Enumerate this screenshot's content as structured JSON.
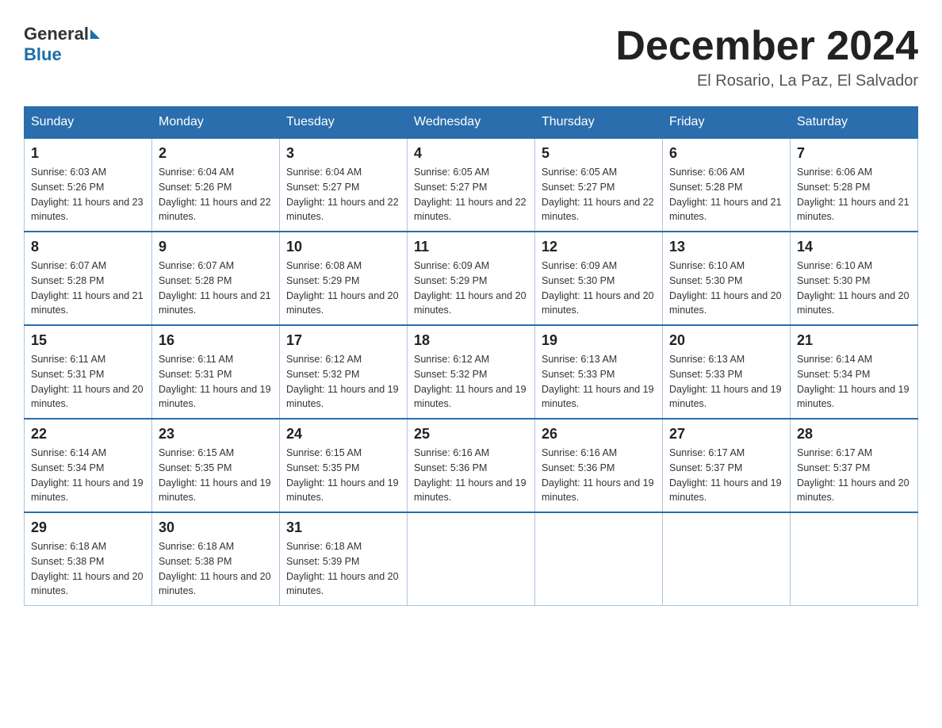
{
  "header": {
    "logo": {
      "general": "General",
      "blue": "Blue"
    },
    "title": "December 2024",
    "location": "El Rosario, La Paz, El Salvador"
  },
  "weekdays": [
    "Sunday",
    "Monday",
    "Tuesday",
    "Wednesday",
    "Thursday",
    "Friday",
    "Saturday"
  ],
  "weeks": [
    [
      {
        "day": "1",
        "sunrise": "6:03 AM",
        "sunset": "5:26 PM",
        "daylight": "11 hours and 23 minutes."
      },
      {
        "day": "2",
        "sunrise": "6:04 AM",
        "sunset": "5:26 PM",
        "daylight": "11 hours and 22 minutes."
      },
      {
        "day": "3",
        "sunrise": "6:04 AM",
        "sunset": "5:27 PM",
        "daylight": "11 hours and 22 minutes."
      },
      {
        "day": "4",
        "sunrise": "6:05 AM",
        "sunset": "5:27 PM",
        "daylight": "11 hours and 22 minutes."
      },
      {
        "day": "5",
        "sunrise": "6:05 AM",
        "sunset": "5:27 PM",
        "daylight": "11 hours and 22 minutes."
      },
      {
        "day": "6",
        "sunrise": "6:06 AM",
        "sunset": "5:28 PM",
        "daylight": "11 hours and 21 minutes."
      },
      {
        "day": "7",
        "sunrise": "6:06 AM",
        "sunset": "5:28 PM",
        "daylight": "11 hours and 21 minutes."
      }
    ],
    [
      {
        "day": "8",
        "sunrise": "6:07 AM",
        "sunset": "5:28 PM",
        "daylight": "11 hours and 21 minutes."
      },
      {
        "day": "9",
        "sunrise": "6:07 AM",
        "sunset": "5:28 PM",
        "daylight": "11 hours and 21 minutes."
      },
      {
        "day": "10",
        "sunrise": "6:08 AM",
        "sunset": "5:29 PM",
        "daylight": "11 hours and 20 minutes."
      },
      {
        "day": "11",
        "sunrise": "6:09 AM",
        "sunset": "5:29 PM",
        "daylight": "11 hours and 20 minutes."
      },
      {
        "day": "12",
        "sunrise": "6:09 AM",
        "sunset": "5:30 PM",
        "daylight": "11 hours and 20 minutes."
      },
      {
        "day": "13",
        "sunrise": "6:10 AM",
        "sunset": "5:30 PM",
        "daylight": "11 hours and 20 minutes."
      },
      {
        "day": "14",
        "sunrise": "6:10 AM",
        "sunset": "5:30 PM",
        "daylight": "11 hours and 20 minutes."
      }
    ],
    [
      {
        "day": "15",
        "sunrise": "6:11 AM",
        "sunset": "5:31 PM",
        "daylight": "11 hours and 20 minutes."
      },
      {
        "day": "16",
        "sunrise": "6:11 AM",
        "sunset": "5:31 PM",
        "daylight": "11 hours and 19 minutes."
      },
      {
        "day": "17",
        "sunrise": "6:12 AM",
        "sunset": "5:32 PM",
        "daylight": "11 hours and 19 minutes."
      },
      {
        "day": "18",
        "sunrise": "6:12 AM",
        "sunset": "5:32 PM",
        "daylight": "11 hours and 19 minutes."
      },
      {
        "day": "19",
        "sunrise": "6:13 AM",
        "sunset": "5:33 PM",
        "daylight": "11 hours and 19 minutes."
      },
      {
        "day": "20",
        "sunrise": "6:13 AM",
        "sunset": "5:33 PM",
        "daylight": "11 hours and 19 minutes."
      },
      {
        "day": "21",
        "sunrise": "6:14 AM",
        "sunset": "5:34 PM",
        "daylight": "11 hours and 19 minutes."
      }
    ],
    [
      {
        "day": "22",
        "sunrise": "6:14 AM",
        "sunset": "5:34 PM",
        "daylight": "11 hours and 19 minutes."
      },
      {
        "day": "23",
        "sunrise": "6:15 AM",
        "sunset": "5:35 PM",
        "daylight": "11 hours and 19 minutes."
      },
      {
        "day": "24",
        "sunrise": "6:15 AM",
        "sunset": "5:35 PM",
        "daylight": "11 hours and 19 minutes."
      },
      {
        "day": "25",
        "sunrise": "6:16 AM",
        "sunset": "5:36 PM",
        "daylight": "11 hours and 19 minutes."
      },
      {
        "day": "26",
        "sunrise": "6:16 AM",
        "sunset": "5:36 PM",
        "daylight": "11 hours and 19 minutes."
      },
      {
        "day": "27",
        "sunrise": "6:17 AM",
        "sunset": "5:37 PM",
        "daylight": "11 hours and 19 minutes."
      },
      {
        "day": "28",
        "sunrise": "6:17 AM",
        "sunset": "5:37 PM",
        "daylight": "11 hours and 20 minutes."
      }
    ],
    [
      {
        "day": "29",
        "sunrise": "6:18 AM",
        "sunset": "5:38 PM",
        "daylight": "11 hours and 20 minutes."
      },
      {
        "day": "30",
        "sunrise": "6:18 AM",
        "sunset": "5:38 PM",
        "daylight": "11 hours and 20 minutes."
      },
      {
        "day": "31",
        "sunrise": "6:18 AM",
        "sunset": "5:39 PM",
        "daylight": "11 hours and 20 minutes."
      },
      null,
      null,
      null,
      null
    ]
  ]
}
